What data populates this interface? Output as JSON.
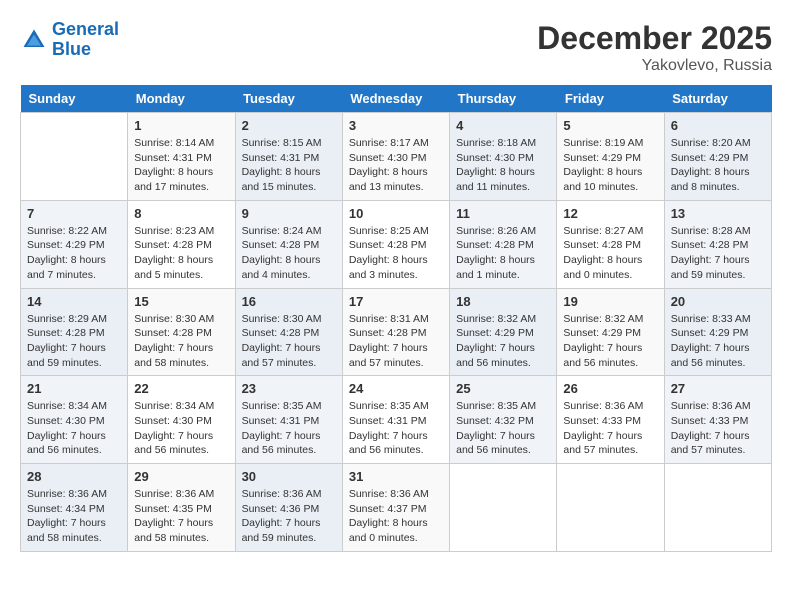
{
  "header": {
    "logo_line1": "General",
    "logo_line2": "Blue",
    "month": "December 2025",
    "location": "Yakovlevo, Russia"
  },
  "weekdays": [
    "Sunday",
    "Monday",
    "Tuesday",
    "Wednesday",
    "Thursday",
    "Friday",
    "Saturday"
  ],
  "weeks": [
    [
      {
        "day": "",
        "info": ""
      },
      {
        "day": "1",
        "info": "Sunrise: 8:14 AM\nSunset: 4:31 PM\nDaylight: 8 hours\nand 17 minutes."
      },
      {
        "day": "2",
        "info": "Sunrise: 8:15 AM\nSunset: 4:31 PM\nDaylight: 8 hours\nand 15 minutes."
      },
      {
        "day": "3",
        "info": "Sunrise: 8:17 AM\nSunset: 4:30 PM\nDaylight: 8 hours\nand 13 minutes."
      },
      {
        "day": "4",
        "info": "Sunrise: 8:18 AM\nSunset: 4:30 PM\nDaylight: 8 hours\nand 11 minutes."
      },
      {
        "day": "5",
        "info": "Sunrise: 8:19 AM\nSunset: 4:29 PM\nDaylight: 8 hours\nand 10 minutes."
      },
      {
        "day": "6",
        "info": "Sunrise: 8:20 AM\nSunset: 4:29 PM\nDaylight: 8 hours\nand 8 minutes."
      }
    ],
    [
      {
        "day": "7",
        "info": "Sunrise: 8:22 AM\nSunset: 4:29 PM\nDaylight: 8 hours\nand 7 minutes."
      },
      {
        "day": "8",
        "info": "Sunrise: 8:23 AM\nSunset: 4:28 PM\nDaylight: 8 hours\nand 5 minutes."
      },
      {
        "day": "9",
        "info": "Sunrise: 8:24 AM\nSunset: 4:28 PM\nDaylight: 8 hours\nand 4 minutes."
      },
      {
        "day": "10",
        "info": "Sunrise: 8:25 AM\nSunset: 4:28 PM\nDaylight: 8 hours\nand 3 minutes."
      },
      {
        "day": "11",
        "info": "Sunrise: 8:26 AM\nSunset: 4:28 PM\nDaylight: 8 hours\nand 1 minute."
      },
      {
        "day": "12",
        "info": "Sunrise: 8:27 AM\nSunset: 4:28 PM\nDaylight: 8 hours\nand 0 minutes."
      },
      {
        "day": "13",
        "info": "Sunrise: 8:28 AM\nSunset: 4:28 PM\nDaylight: 7 hours\nand 59 minutes."
      }
    ],
    [
      {
        "day": "14",
        "info": "Sunrise: 8:29 AM\nSunset: 4:28 PM\nDaylight: 7 hours\nand 59 minutes."
      },
      {
        "day": "15",
        "info": "Sunrise: 8:30 AM\nSunset: 4:28 PM\nDaylight: 7 hours\nand 58 minutes."
      },
      {
        "day": "16",
        "info": "Sunrise: 8:30 AM\nSunset: 4:28 PM\nDaylight: 7 hours\nand 57 minutes."
      },
      {
        "day": "17",
        "info": "Sunrise: 8:31 AM\nSunset: 4:28 PM\nDaylight: 7 hours\nand 57 minutes."
      },
      {
        "day": "18",
        "info": "Sunrise: 8:32 AM\nSunset: 4:29 PM\nDaylight: 7 hours\nand 56 minutes."
      },
      {
        "day": "19",
        "info": "Sunrise: 8:32 AM\nSunset: 4:29 PM\nDaylight: 7 hours\nand 56 minutes."
      },
      {
        "day": "20",
        "info": "Sunrise: 8:33 AM\nSunset: 4:29 PM\nDaylight: 7 hours\nand 56 minutes."
      }
    ],
    [
      {
        "day": "21",
        "info": "Sunrise: 8:34 AM\nSunset: 4:30 PM\nDaylight: 7 hours\nand 56 minutes."
      },
      {
        "day": "22",
        "info": "Sunrise: 8:34 AM\nSunset: 4:30 PM\nDaylight: 7 hours\nand 56 minutes."
      },
      {
        "day": "23",
        "info": "Sunrise: 8:35 AM\nSunset: 4:31 PM\nDaylight: 7 hours\nand 56 minutes."
      },
      {
        "day": "24",
        "info": "Sunrise: 8:35 AM\nSunset: 4:31 PM\nDaylight: 7 hours\nand 56 minutes."
      },
      {
        "day": "25",
        "info": "Sunrise: 8:35 AM\nSunset: 4:32 PM\nDaylight: 7 hours\nand 56 minutes."
      },
      {
        "day": "26",
        "info": "Sunrise: 8:36 AM\nSunset: 4:33 PM\nDaylight: 7 hours\nand 57 minutes."
      },
      {
        "day": "27",
        "info": "Sunrise: 8:36 AM\nSunset: 4:33 PM\nDaylight: 7 hours\nand 57 minutes."
      }
    ],
    [
      {
        "day": "28",
        "info": "Sunrise: 8:36 AM\nSunset: 4:34 PM\nDaylight: 7 hours\nand 58 minutes."
      },
      {
        "day": "29",
        "info": "Sunrise: 8:36 AM\nSunset: 4:35 PM\nDaylight: 7 hours\nand 58 minutes."
      },
      {
        "day": "30",
        "info": "Sunrise: 8:36 AM\nSunset: 4:36 PM\nDaylight: 7 hours\nand 59 minutes."
      },
      {
        "day": "31",
        "info": "Sunrise: 8:36 AM\nSunset: 4:37 PM\nDaylight: 8 hours\nand 0 minutes."
      },
      {
        "day": "",
        "info": ""
      },
      {
        "day": "",
        "info": ""
      },
      {
        "day": "",
        "info": ""
      }
    ]
  ]
}
